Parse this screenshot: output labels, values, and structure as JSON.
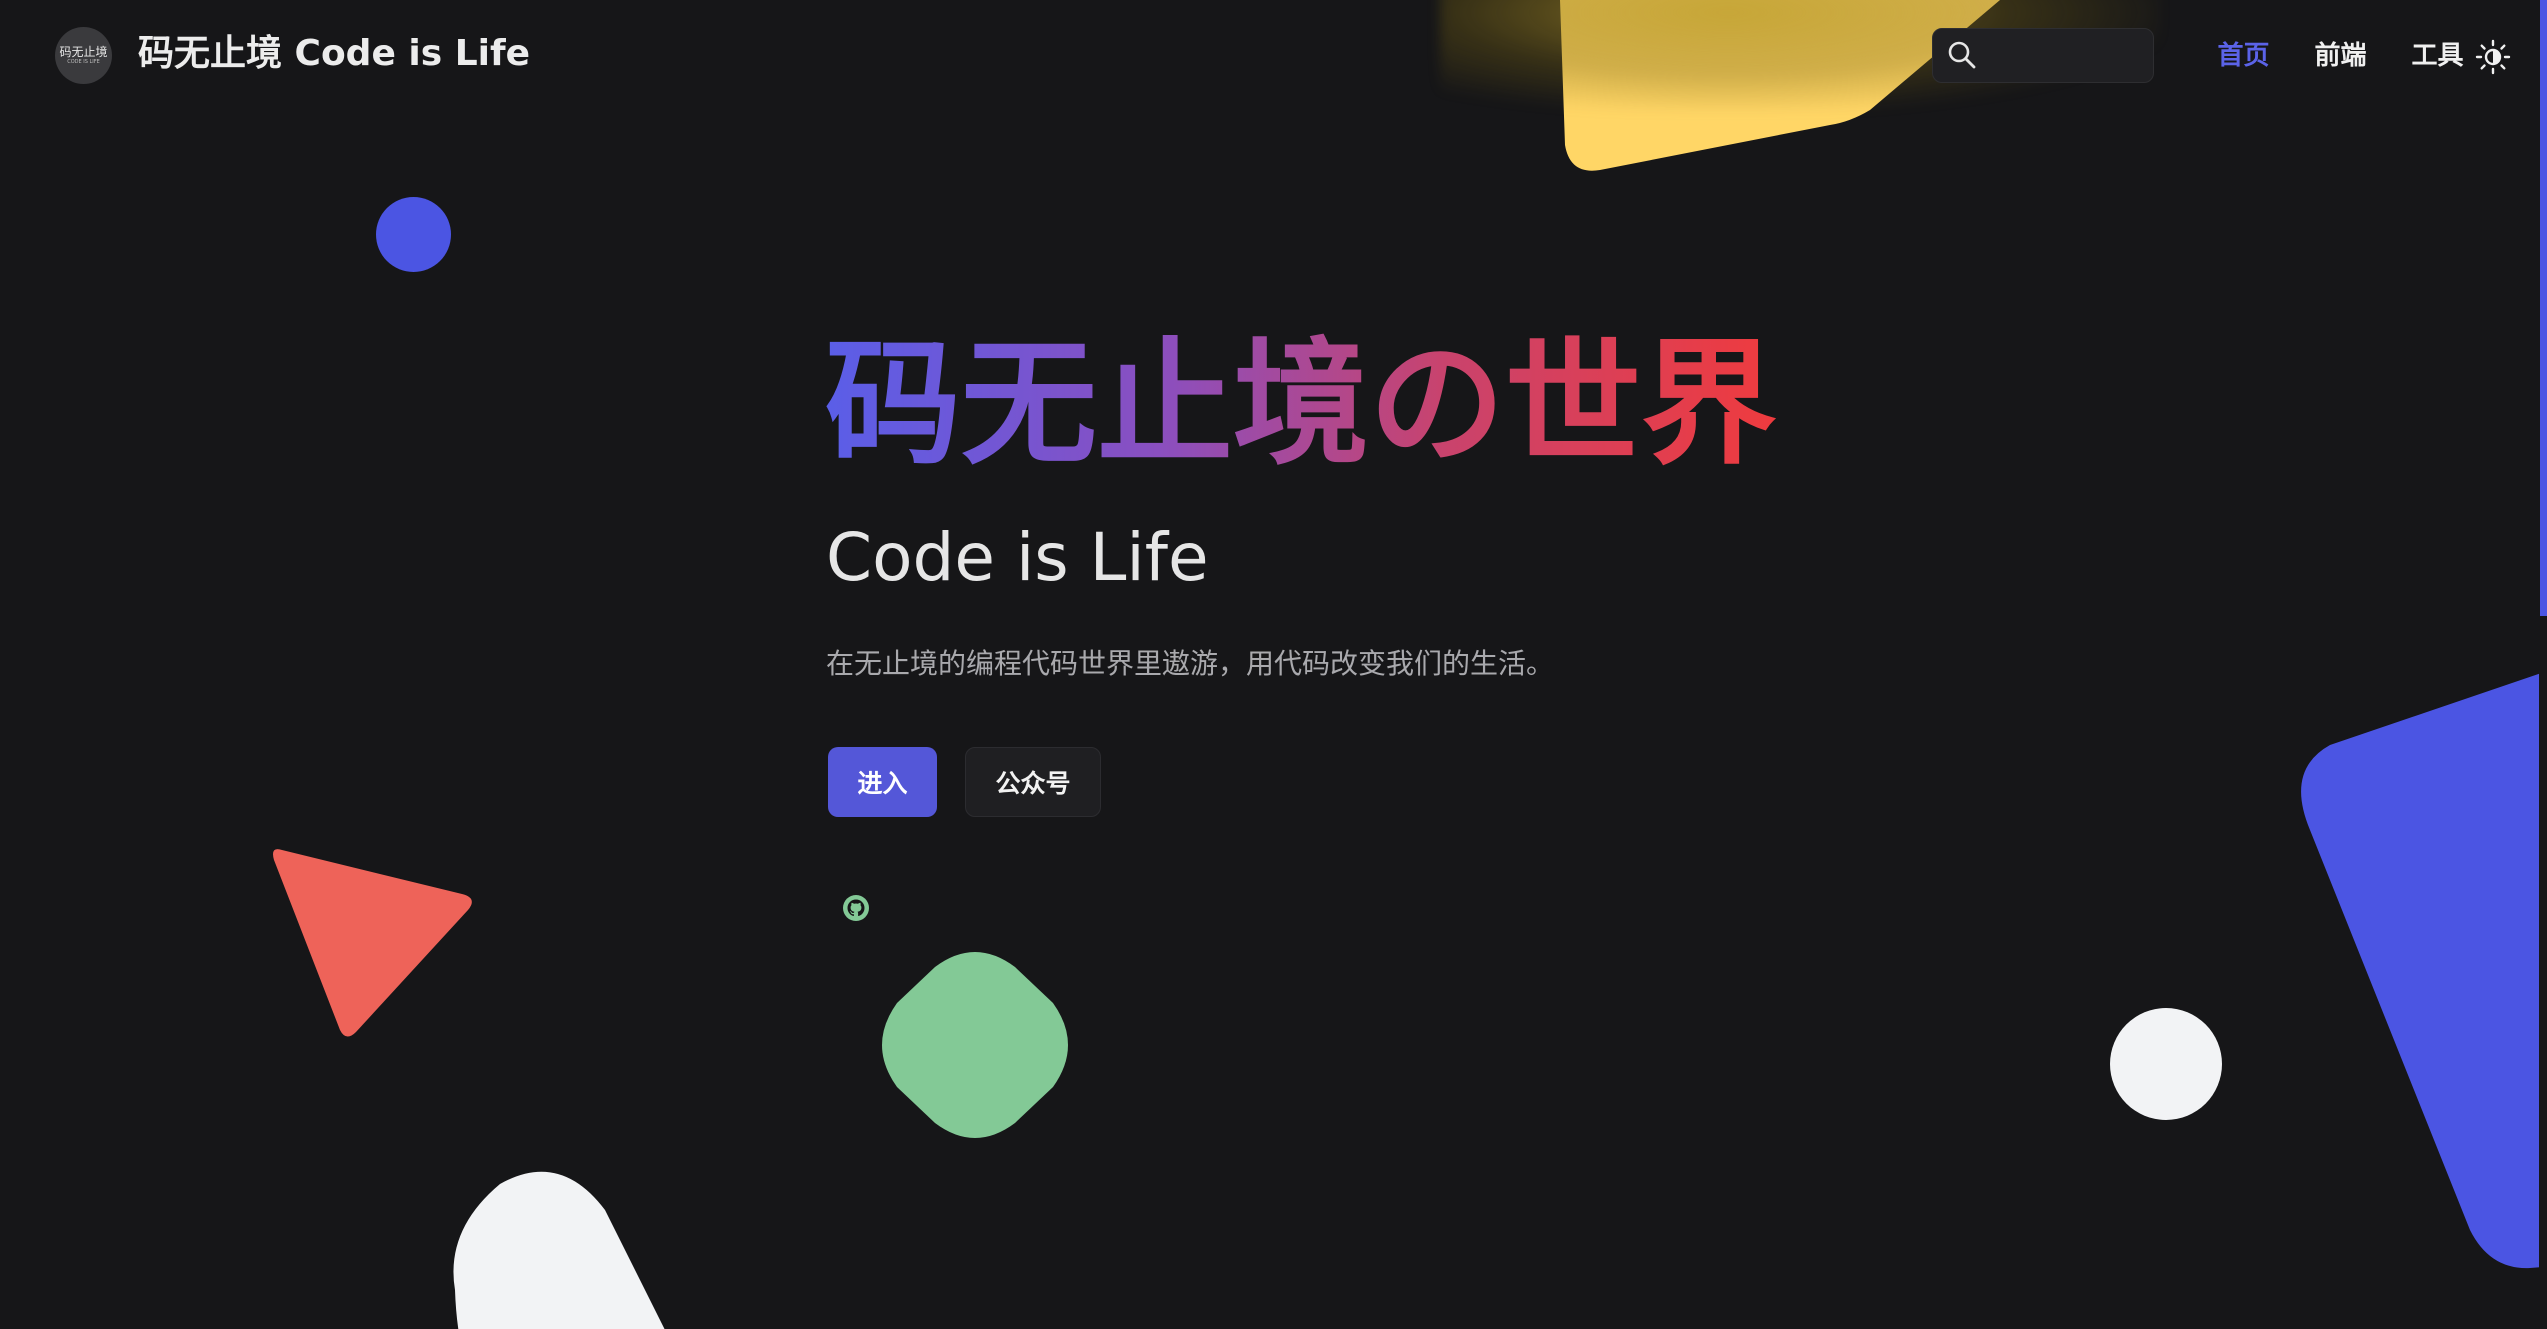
{
  "header": {
    "logo_text": "码无止境",
    "logo_subtext": "CODE IS LIFE",
    "site_title": "码无止境 Code is Life",
    "search": {
      "placeholder": "",
      "value": ""
    },
    "nav": [
      {
        "label": "首页",
        "active": true
      },
      {
        "label": "前端",
        "active": false
      },
      {
        "label": "工具",
        "active": false
      }
    ],
    "theme_toggle_icon": "sun-icon"
  },
  "hero": {
    "title": "码无止境の世界",
    "subtitle": "Code is Life",
    "description": "在无止境的编程代码世界里遨游，用代码改变我们的生活。",
    "primary_button": "进入",
    "secondary_button": "公众号",
    "social_icon": "github-icon"
  },
  "colors": {
    "background": "#161618",
    "accent": "#5457d8",
    "nav_active": "#5b63e8",
    "title_gradient_start": "#5a5ee8",
    "title_gradient_end": "#ef3b3e",
    "shape_blue": "#4b55e3",
    "shape_red": "#ee6359",
    "shape_green": "#83c996",
    "shape_yellow": "#ffd666",
    "shape_white": "#f2f3f5"
  }
}
